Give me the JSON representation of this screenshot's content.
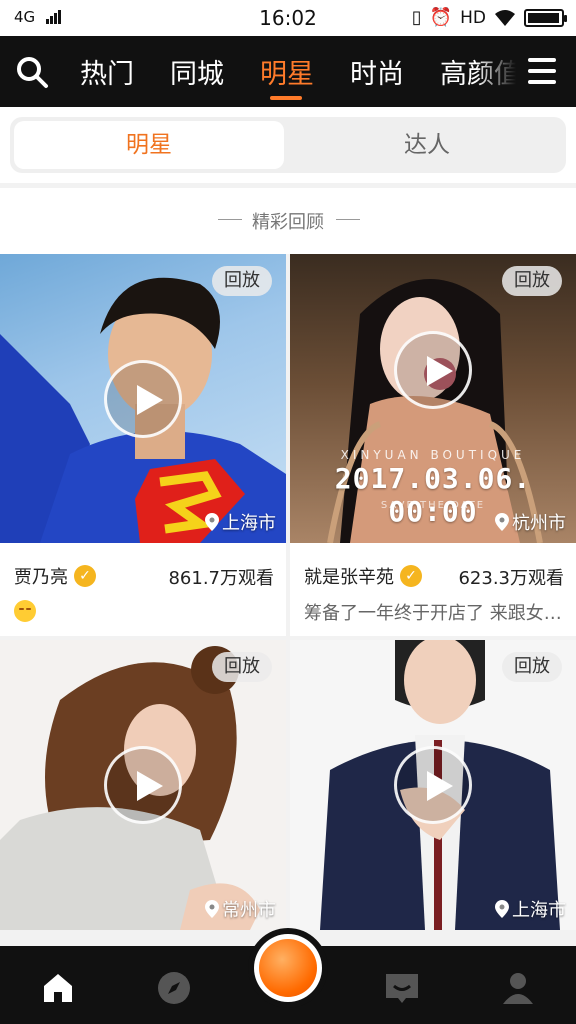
{
  "status_bar": {
    "network": "4G",
    "time": "16:02",
    "hd": "HD"
  },
  "top_nav": {
    "tabs": [
      {
        "label": "热门"
      },
      {
        "label": "同城"
      },
      {
        "label": "明星"
      },
      {
        "label": "时尚"
      },
      {
        "label": "高颜值"
      }
    ],
    "active_tab": "明星",
    "accent_color": "#ff7b2a"
  },
  "segment": {
    "options": [
      "明星",
      "达人"
    ],
    "active": "明星"
  },
  "section": {
    "title": "精彩回顾"
  },
  "cards": [
    {
      "badge": "回放",
      "location": "上海市",
      "name": "贾乃亮",
      "verified": true,
      "views": "861.7万观看",
      "has_emoji": true
    },
    {
      "badge": "回放",
      "location": "杭州市",
      "name": "就是张辛苑",
      "verified": true,
      "views": "623.3万观看",
      "desc": "筹备了一年终于开店了 来跟女…",
      "overlay_brand": "XINYUAN BOUTIQUE",
      "overlay_date": "2017.03.06.  00:00",
      "overlay_sub": "SAVE THE DATE"
    },
    {
      "badge": "回放",
      "location": "常州市"
    },
    {
      "badge": "回放",
      "location": "上海市"
    }
  ],
  "bottom_nav": {
    "items": [
      "home-icon",
      "compass-icon",
      "record-button",
      "message-icon",
      "profile-icon"
    ]
  }
}
